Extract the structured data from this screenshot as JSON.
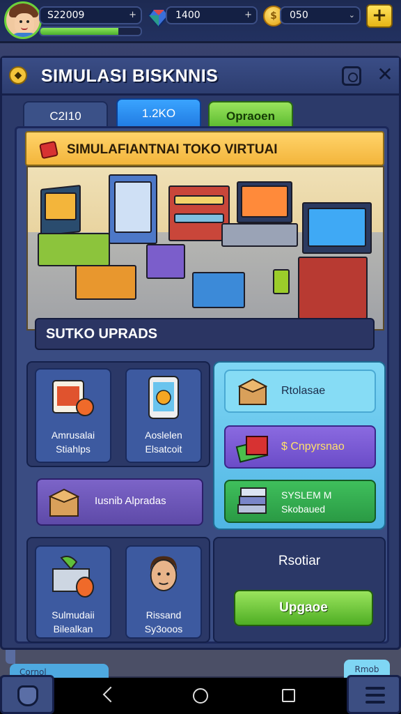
{
  "topbar": {
    "money": "S22009",
    "money_plus": "+",
    "xp_progress": 0.78,
    "gems": "1400",
    "gems_plus": "+",
    "coins": "050",
    "coins_chevron": "⌄",
    "add_label": "+"
  },
  "panel": {
    "title": "SIMULASI BISKNNIS",
    "close_label": "✕"
  },
  "tabs": [
    {
      "label": "C2I10"
    },
    {
      "label": "1.2KO"
    },
    {
      "label": "Opraoen"
    }
  ],
  "banner": {
    "title": "SIMULAFIANTNAI TOKO VIRTUAI"
  },
  "upgrades_section": {
    "label": "SUTKO UPRADS"
  },
  "left_cards": [
    {
      "line1": "Amrusalai",
      "line2": "Stiahlps"
    },
    {
      "line1": "Aoslelen",
      "line2": "Elsatcoit"
    }
  ],
  "wide_card": {
    "label": "Iusnib Alpradas"
  },
  "bottom_cards": [
    {
      "line1": "Sulmudaii",
      "line2": "Bilealkan"
    },
    {
      "line1": "Rissand",
      "line2": "Sy3ooos"
    }
  ],
  "right_buttons": [
    {
      "label": "Rtolasae"
    },
    {
      "label": "$ Cnpyrsnao"
    },
    {
      "line1": "SYSLEM M",
      "line2": "Skobaued"
    }
  ],
  "right_bottom": {
    "label": "Rsotiar",
    "upgrade_button": "Upgaoe"
  },
  "peeks": {
    "left": "Cornol",
    "right": "Rmob"
  },
  "colors": {
    "accent_blue": "#1f78e0",
    "accent_green": "#57b82d",
    "accent_yellow": "#f3b53b",
    "panel_bg": "#2c3a6a"
  },
  "icons": [
    "avatar",
    "gem-icon",
    "coin-icon",
    "add-icon",
    "store-icon",
    "camera-icon",
    "close-icon",
    "box-icon",
    "nav-back-icon",
    "nav-home-icon",
    "nav-recent-icon",
    "menu-icon"
  ]
}
